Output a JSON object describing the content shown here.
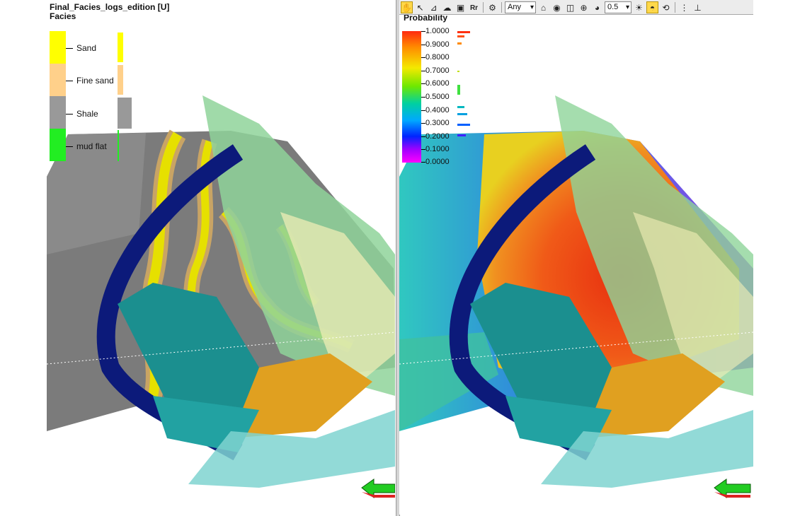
{
  "left_view": {
    "title": "Final_Facies_logs_edition [U]",
    "subtitle": "Facies",
    "legend": [
      {
        "label": "Sand",
        "color": "#ffff00",
        "bar_fraction": 1.0
      },
      {
        "label": "Fine sand",
        "color": "#ffd08a",
        "bar_fraction": 1.0
      },
      {
        "label": "Shale",
        "color": "#999999",
        "bar_fraction": 1.0
      },
      {
        "label": "mud flat",
        "color": "#22ee22",
        "bar_fraction": 1.0
      }
    ]
  },
  "right_view": {
    "legend_title": "Probability",
    "scale_labels": [
      "1.0000",
      "0.9000",
      "0.8000",
      "0.7000",
      "0.6000",
      "0.5000",
      "0.4000",
      "0.3000",
      "0.2000",
      "0.1000",
      "0.0000"
    ]
  },
  "toolbar": {
    "filter_value": "Any",
    "opacity_value": "0.5",
    "icons": [
      "select-mode-icon",
      "pointer-icon",
      "measure-icon",
      "pan-icon",
      "link-icon",
      "text-icon",
      "view-icon",
      "home-icon",
      "eye-icon",
      "frame-icon",
      "target-icon",
      "palette-icon",
      "light-icon",
      "overlay-icon",
      "rotate-icon",
      "pin-icon",
      "pushpin-icon"
    ]
  },
  "colors": {
    "shale": "#7a7a7a",
    "sand": "#e6e000",
    "fine_sand": "#c9a464",
    "fault_green": "#8fd49a",
    "fault_blue": "#0c1a7a",
    "fault_teal": "#1b8f8f",
    "fault_orange": "#e0a020"
  }
}
